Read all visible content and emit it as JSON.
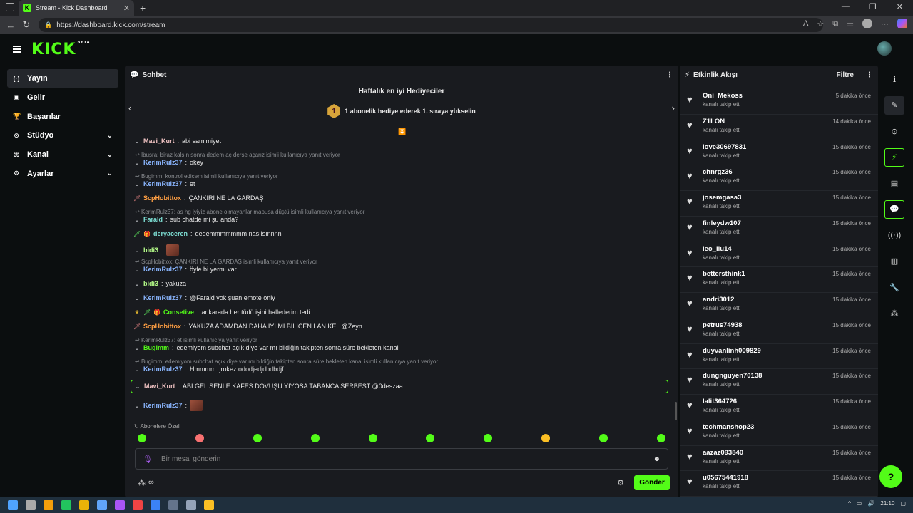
{
  "browser": {
    "tab_title": "Stream - Kick Dashboard",
    "url": "https://dashboard.kick.com/stream"
  },
  "app": {
    "logo": "KICK",
    "beta": "BETA"
  },
  "nav": [
    {
      "icon": "(·)",
      "label": "Yayın",
      "active": true,
      "expand": false
    },
    {
      "icon": "▣",
      "label": "Gelir",
      "active": false,
      "expand": false
    },
    {
      "icon": "🏆",
      "label": "Başarılar",
      "active": false,
      "expand": false
    },
    {
      "icon": "⊙",
      "label": "Stüdyo",
      "active": false,
      "expand": true
    },
    {
      "icon": "⌘",
      "label": "Kanal",
      "active": false,
      "expand": true
    },
    {
      "icon": "⚙",
      "label": "Ayarlar",
      "active": false,
      "expand": true
    }
  ],
  "chat": {
    "title": "Sohbet",
    "gifters_title": "Haftalık en iyi Hediyeciler",
    "gifter_rank": "1",
    "gifter_text": "1 abonelik hediye ederek 1. sıraya yükselin",
    "messages": [
      {
        "reply": "",
        "user": "Mavi_Kurt",
        "color": "c-pink",
        "text": "abi samimiyet",
        "badge": "v",
        "emote": false
      },
      {
        "reply": "Ibusra: biraz kalsın sonra dedem aç derse açarız isimli kullanıcıya yanıt veriyor",
        "user": "KerimRulz37",
        "color": "c-blue",
        "text": "okey",
        "badge": "v",
        "emote": false
      },
      {
        "reply": "Bugimm: kontrol edicem isimli kullanıcıya yanıt veriyor",
        "user": "KerimRulz37",
        "color": "c-blue",
        "text": "et",
        "badge": "v",
        "emote": false
      },
      {
        "reply": "",
        "user": "ScpHobittox",
        "color": "c-orange",
        "text": "ÇANKIRI NE LA GARDAŞ",
        "badge": "sword",
        "emote": false
      },
      {
        "reply": "KerimRulz37: as hg iyiyiz abone olmayanlar mapusa düştü isimli kullanıcıya yanıt veriyor",
        "user": "Farald",
        "color": "c-teal",
        "text": "sub chatde mi şu anda?",
        "badge": "v",
        "emote": false
      },
      {
        "reply": "",
        "user": "deryaceren",
        "color": "c-teal",
        "text": "dedemmmmmmm nasılsınnnn",
        "badge": "sword-gift",
        "emote": false
      },
      {
        "reply": "",
        "user": "bidi3",
        "color": "c-lime",
        "text": "",
        "badge": "v",
        "emote": true
      },
      {
        "reply": "ScpHobittox: ÇANKIRI NE LA GARDAŞ isimli kullanıcıya yanıt veriyor",
        "user": "KerimRulz37",
        "color": "c-blue",
        "text": "öyle bi yermi var",
        "badge": "v",
        "emote": false
      },
      {
        "reply": "",
        "user": "bidi3",
        "color": "c-lime",
        "text": "yakuza",
        "badge": "v",
        "emote": false
      },
      {
        "reply": "",
        "user": "KerimRulz37",
        "color": "c-blue",
        "text": "@Farald yok şuan emote only",
        "badge": "v",
        "emote": false
      },
      {
        "reply": "",
        "user": "Consetive",
        "color": "c-green",
        "text": "ankarada her türlü işini hallederim tedi",
        "badge": "crown",
        "emote": false
      },
      {
        "reply": "",
        "user": "ScpHobittox",
        "color": "c-orange",
        "text": "YAKUZA ADAMDAN DAHA İYİ Mİ BİLİCEN LAN KEL @Zeyn",
        "badge": "sword",
        "emote": false
      },
      {
        "reply": "KerimRulz37: et isimli kullanıcıya yanıt veriyor",
        "user": "Bugimm",
        "color": "c-green",
        "text": "edemiyom subchat açık diye var mı bildiğin takipten sonra süre bekleten kanal",
        "badge": "v",
        "emote": false
      },
      {
        "reply": "Bugimm: edemiyom subchat açık diye var mı bildiğin takipten sonra süre bekleten kanal isimli kullanıcıya yanıt veriyor",
        "user": "KerimRulz37",
        "color": "c-blue",
        "text": "Hmmmm. jrokez ododjedjdbdbdjf",
        "badge": "v",
        "emote": false
      },
      {
        "reply": "",
        "user": "Mavi_Kurt",
        "color": "c-pink",
        "text": "ABİ GEL SENLE KAFES DÖVÜŞÜ YİYOSA TABANCA SERBEST @0deszaa",
        "badge": "v",
        "emote": false,
        "highlight": true
      },
      {
        "reply": "",
        "user": "KerimRulz37",
        "color": "c-blue",
        "text": "",
        "badge": "v",
        "emote": true
      }
    ],
    "sub_only_label": "Abonelere Özel",
    "input_placeholder": "Bir mesaj gönderin",
    "send_label": "Gönder"
  },
  "activity": {
    "title": "Etkinlik Akışı",
    "filter_label": "Filtre",
    "items": [
      {
        "name": "Oni_Mekoss",
        "sub": "kanalı takip etti",
        "time": "5 dakika önce"
      },
      {
        "name": "Z1LON",
        "sub": "kanalı takip etti",
        "time": "14 dakika önce"
      },
      {
        "name": "love30697831",
        "sub": "kanalı takip etti",
        "time": "15 dakika önce"
      },
      {
        "name": "chnrgz36",
        "sub": "kanalı takip etti",
        "time": "15 dakika önce"
      },
      {
        "name": "josemgasa3",
        "sub": "kanalı takip etti",
        "time": "15 dakika önce"
      },
      {
        "name": "finleydw107",
        "sub": "kanalı takip etti",
        "time": "15 dakika önce"
      },
      {
        "name": "leo_liu14",
        "sub": "kanalı takip etti",
        "time": "15 dakika önce"
      },
      {
        "name": "bettersthink1",
        "sub": "kanalı takip etti",
        "time": "15 dakika önce"
      },
      {
        "name": "andri3012",
        "sub": "kanalı takip etti",
        "time": "15 dakika önce"
      },
      {
        "name": "petrus74938",
        "sub": "kanalı takip etti",
        "time": "15 dakika önce"
      },
      {
        "name": "duyvanlinh009829",
        "sub": "kanalı takip etti",
        "time": "15 dakika önce"
      },
      {
        "name": "dungnguyen70138",
        "sub": "kanalı takip etti",
        "time": "15 dakika önce"
      },
      {
        "name": "lalit364726",
        "sub": "kanalı takip etti",
        "time": "15 dakika önce"
      },
      {
        "name": "techmanshop23",
        "sub": "kanalı takip etti",
        "time": "15 dakika önce"
      },
      {
        "name": "aazaz093840",
        "sub": "kanalı takip etti",
        "time": "15 dakika önce"
      },
      {
        "name": "u05675441918",
        "sub": "kanalı takip etti",
        "time": "15 dakika önce"
      }
    ]
  },
  "taskbar": {
    "time": "21:10"
  }
}
